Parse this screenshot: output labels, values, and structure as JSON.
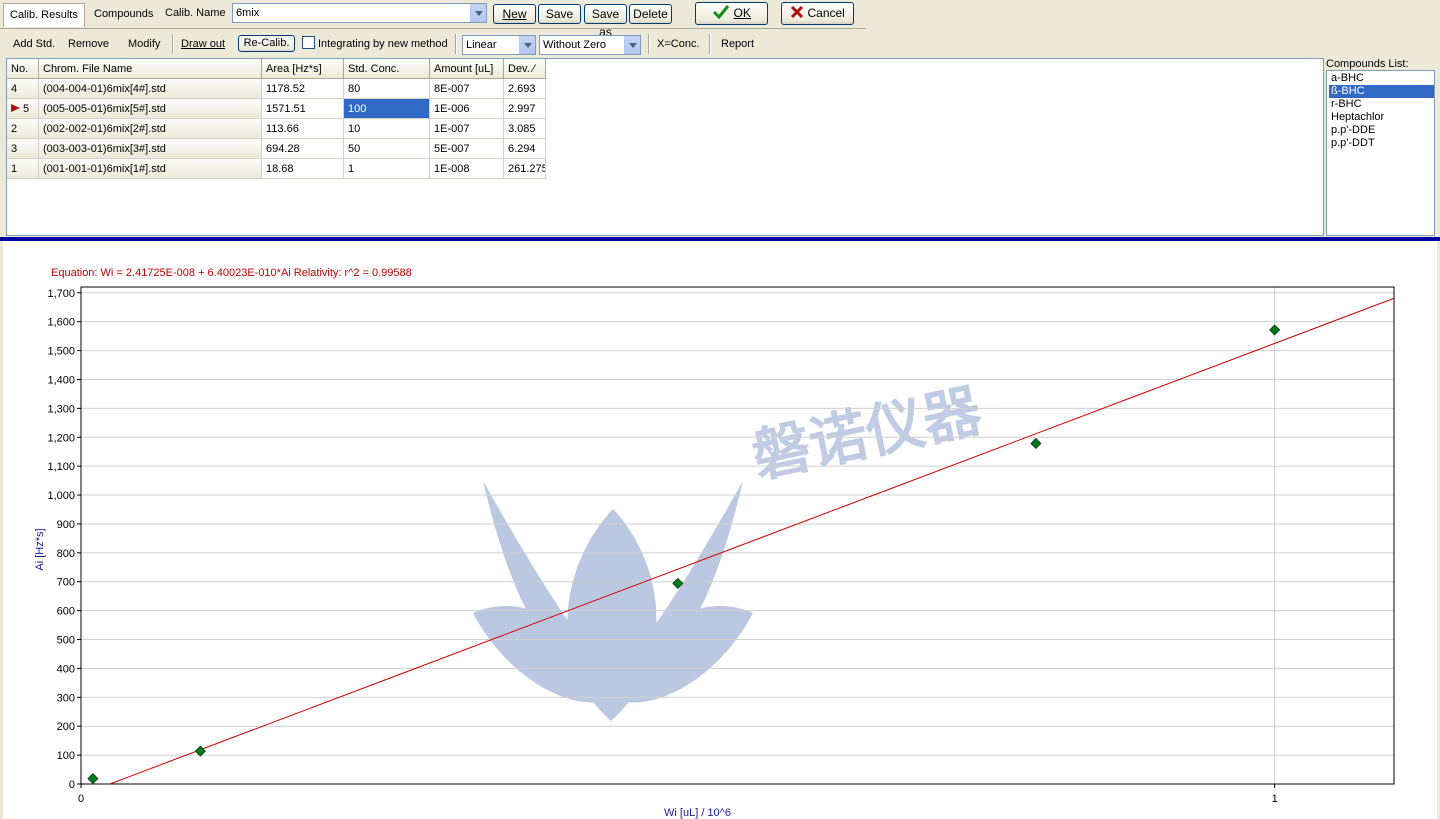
{
  "tabs": [
    "Calib. Results",
    "Compounds"
  ],
  "calib_name": {
    "label": "Calib. Name",
    "value": "6mix"
  },
  "buttons": {
    "new": "New",
    "save": "Save",
    "save_as": "Save as",
    "delete": "Delete",
    "ok": "OK",
    "cancel": "Cancel"
  },
  "toolbar": {
    "add_std": "Add Std.",
    "remove": "Remove",
    "modify": "Modify",
    "draw_out": "Draw out",
    "re_calib": "Re-Calib.",
    "integrating": "Integrating by new method",
    "integrating_checked": false,
    "fit_type": "Linear",
    "zero_mode": "Without Zero",
    "x_conc": "X=Conc.",
    "report": "Report"
  },
  "table": {
    "columns": [
      "No.",
      "Chrom. File Name",
      "Area [Hz*s]",
      "Std. Conc.",
      "Amount [uL]",
      "Dev. ∕"
    ],
    "rows": [
      [
        "4",
        "(004-004-01)6mix[4#].std",
        "1178.52",
        "80",
        "8E-007",
        "2.693"
      ],
      [
        "5",
        "(005-005-01)6mix[5#].std",
        "1571.51",
        "100",
        "1E-006",
        "2.997"
      ],
      [
        "2",
        "(002-002-01)6mix[2#].std",
        "113.66",
        "10",
        "1E-007",
        "3.085"
      ],
      [
        "3",
        "(003-003-01)6mix[3#].std",
        "694.28",
        "50",
        "5E-007",
        "6.294"
      ],
      [
        "1",
        "(001-001-01)6mix[1#].std",
        "18.68",
        "1",
        "1E-008",
        "261.275"
      ]
    ],
    "current_row": 1,
    "selected_cell": "Std. Conc."
  },
  "compounds": {
    "title": "Compounds List:",
    "items": [
      "a-BHC",
      "ß-BHC",
      "r-BHC",
      "Heptachlor",
      "p.p'-DDE",
      "p.p'-DDT"
    ],
    "selected": 1
  },
  "watermark": "磐诺仪器",
  "colors": {
    "accent": "#0000a0",
    "selection": "#316ac5",
    "equation": "#c00000",
    "fit_line": "#cc0000",
    "marker": "#007a1f"
  },
  "chart_data": {
    "type": "scatter",
    "equation": "Equation: Wi = 2.41725E-008 + 6.40023E-010*Ai    Relativity: r^2 = 0.99588",
    "xlabel": "Wi [uL] / 10^6",
    "ylabel": "Ai [Hz*s]",
    "xlim": [
      0,
      1.1
    ],
    "ylim": [
      0,
      1720
    ],
    "xticks": [
      0,
      1
    ],
    "yticks": [
      0,
      100,
      200,
      300,
      400,
      500,
      600,
      700,
      800,
      900,
      1000,
      1100,
      1200,
      1300,
      1400,
      1500,
      1600,
      1700
    ],
    "ytick_labels": [
      "0",
      "100",
      "200",
      "300",
      "400",
      "500",
      "600",
      "700",
      "800",
      "900",
      "1,000",
      "1,100",
      "1,200",
      "1,300",
      "1,400",
      "1,500",
      "1,600",
      "1,700"
    ],
    "grid": true,
    "points": {
      "x": [
        0.01,
        0.1,
        0.5,
        0.8,
        1.0
      ],
      "y": [
        18.68,
        113.66,
        694.28,
        1178.52,
        1571.51
      ]
    },
    "fit_line": {
      "x": [
        0.02417,
        1.1
      ],
      "y": [
        0,
        1681
      ]
    }
  }
}
